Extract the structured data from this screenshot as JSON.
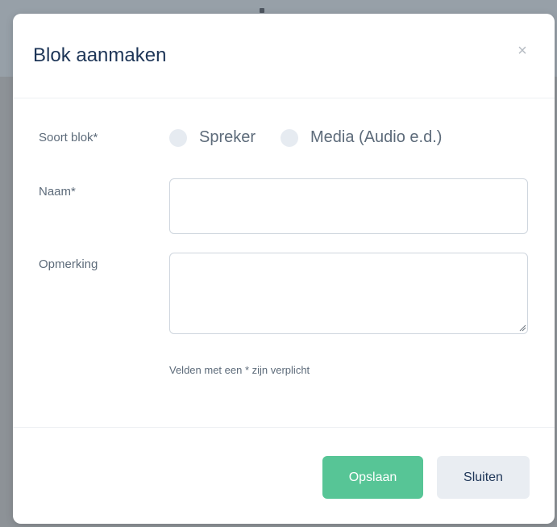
{
  "modal": {
    "title": "Blok aanmaken",
    "close_icon": "close-icon",
    "close_glyph": "×"
  },
  "form": {
    "type": {
      "label": "Soort blok*",
      "options": [
        {
          "label": "Spreker",
          "selected": false
        },
        {
          "label": "Media (Audio e.d.)",
          "selected": false
        }
      ]
    },
    "name": {
      "label": "Naam*",
      "value": "",
      "placeholder": ""
    },
    "remark": {
      "label": "Opmerking",
      "value": "",
      "placeholder": ""
    },
    "hint": "Velden met een * zijn verplicht"
  },
  "footer": {
    "save_label": "Opslaan",
    "close_label": "Sluiten"
  },
  "colors": {
    "primary": "#57c596",
    "secondary": "#e9edf2",
    "title": "#1d3557",
    "text": "#5d6b7a",
    "backdrop": "#8d9297"
  }
}
